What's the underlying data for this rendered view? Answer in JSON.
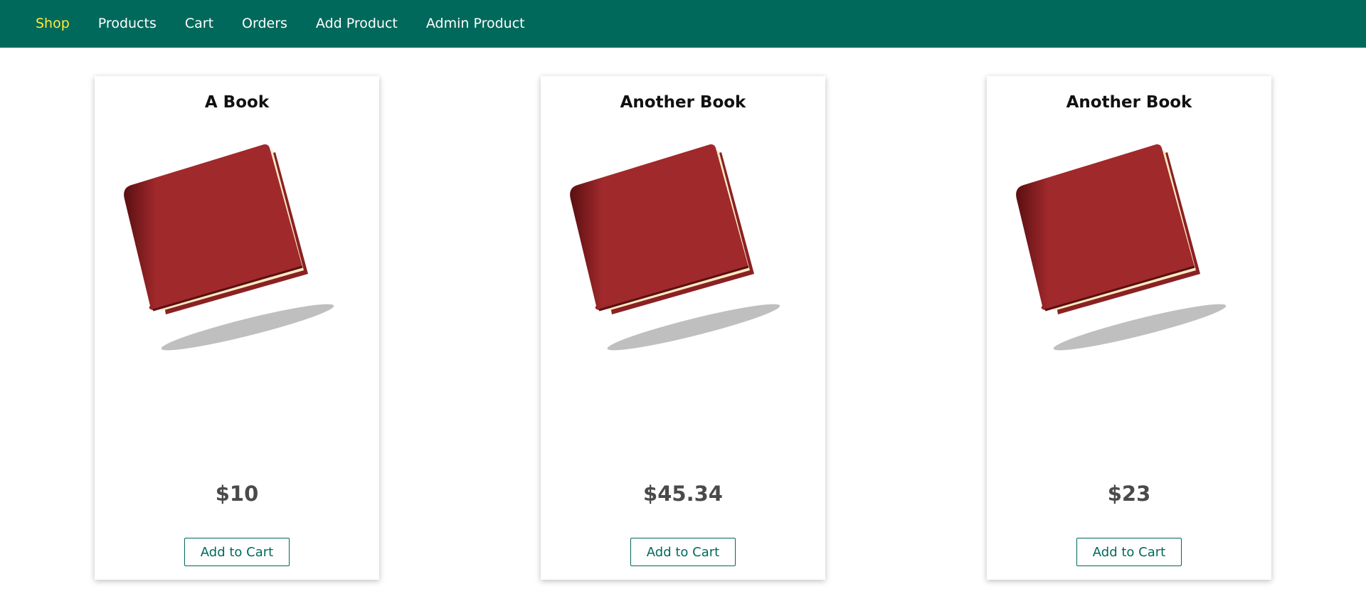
{
  "nav": {
    "items": [
      {
        "label": "Shop",
        "active": true
      },
      {
        "label": "Products",
        "active": false
      },
      {
        "label": "Cart",
        "active": false
      },
      {
        "label": "Orders",
        "active": false
      },
      {
        "label": "Add Product",
        "active": false
      },
      {
        "label": "Admin Product",
        "active": false
      }
    ]
  },
  "products": [
    {
      "title": "A Book",
      "price": "$10",
      "button_label": "Add to Cart",
      "image_icon": "book-icon"
    },
    {
      "title": "Another Book",
      "price": "$45.34",
      "button_label": "Add to Cart",
      "image_icon": "book-icon"
    },
    {
      "title": "Another Book",
      "price": "$23",
      "button_label": "Add to Cart",
      "image_icon": "book-icon"
    }
  ],
  "colors": {
    "header_bg": "#00695c",
    "nav_active": "#ffeb3b",
    "nav_text": "#ffffff",
    "book_cover": "#a0292b",
    "book_pages": "#fbeac0",
    "price_text": "#4a4a4a",
    "button_accent": "#00695c"
  }
}
